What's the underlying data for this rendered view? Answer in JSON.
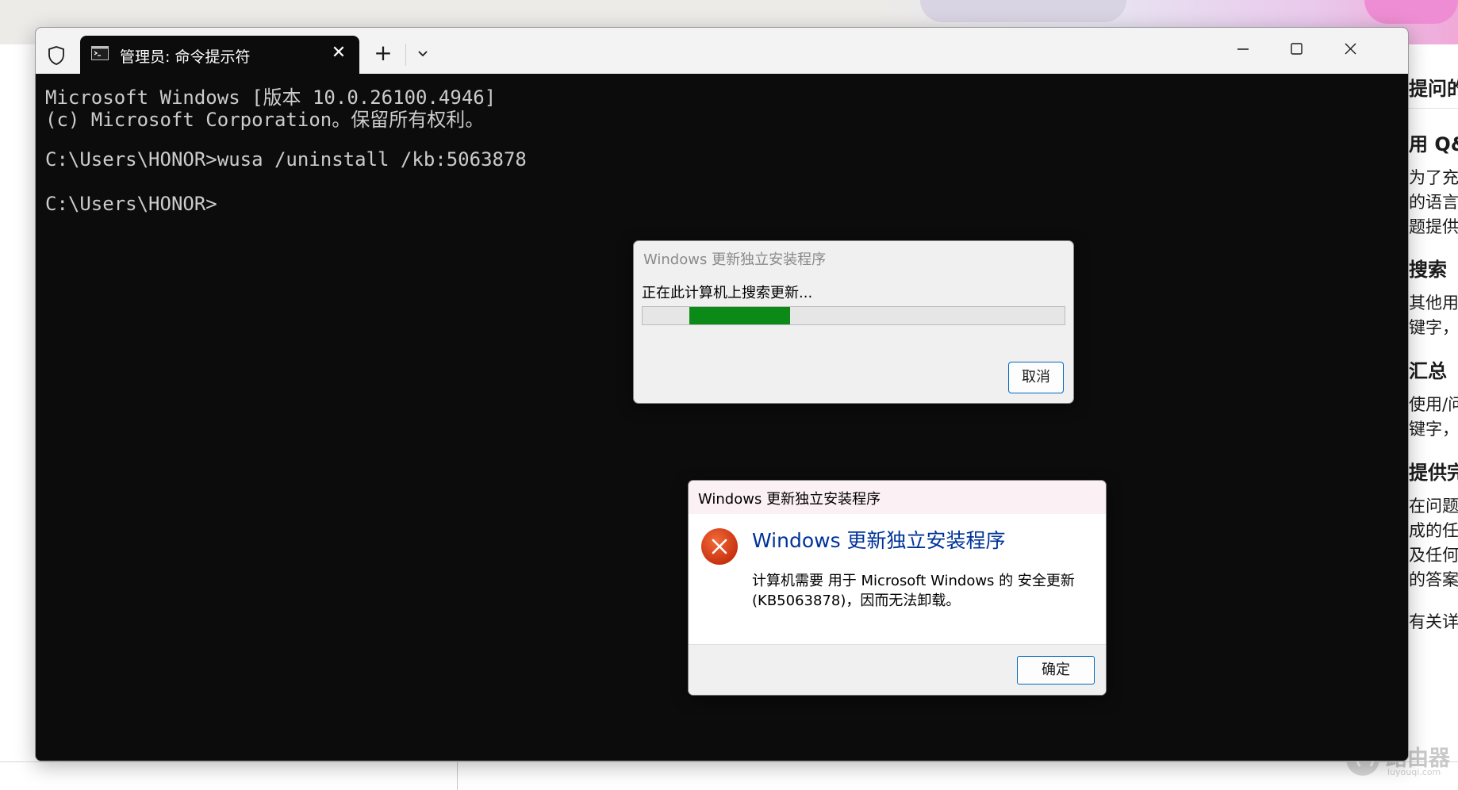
{
  "terminal": {
    "tab_title": "管理员: 命令提示符",
    "lines": [
      "Microsoft Windows [版本 10.0.26100.4946]",
      "(c) Microsoft Corporation。保留所有权利。",
      "",
      "C:\\Users\\HONOR>wusa /uninstall /kb:5063878",
      "",
      "C:\\Users\\HONOR>"
    ],
    "new_tab_label": "+",
    "close_tab_label": "✕"
  },
  "progress_dialog": {
    "title": "Windows 更新独立安装程序",
    "status": "正在此计算机上搜索更新...",
    "progress_segment": {
      "start": 0.11,
      "end": 0.35
    },
    "cancel_label": "取消",
    "bar_color": "#0b8a17"
  },
  "error_dialog": {
    "title": "Windows 更新独立安装程序",
    "heading": "Windows 更新独立安装程序",
    "message_line1": "计算机需要 用于 Microsoft Windows 的 安全更新",
    "message_line2": "(KB5063878)，因而无法卸载。",
    "ok_label": "确定",
    "icon": "error-icon",
    "accent": "#d83b01"
  },
  "background_article": {
    "lines": [
      {
        "text": "提问的",
        "kind": "h"
      },
      {
        "text": "用 Q&",
        "kind": "h"
      },
      {
        "text": "为了充",
        "kind": "p"
      },
      {
        "text": "的语言",
        "kind": "p"
      },
      {
        "text": "题提供",
        "kind": "p"
      },
      {
        "text": "搜索",
        "kind": "h"
      },
      {
        "text": "其他用",
        "kind": "p"
      },
      {
        "text": "键字，",
        "kind": "p"
      },
      {
        "text": "汇总",
        "kind": "h"
      },
      {
        "text": "使用/问",
        "kind": "p"
      },
      {
        "text": "键字，",
        "kind": "p"
      },
      {
        "text": "提供完",
        "kind": "h"
      },
      {
        "text": "在问题",
        "kind": "p"
      },
      {
        "text": "成的任",
        "kind": "p"
      },
      {
        "text": "及任何",
        "kind": "p"
      },
      {
        "text": "的答案",
        "kind": "p"
      },
      {
        "text": "有关详",
        "kind": "p"
      }
    ]
  },
  "watermark": {
    "text": "路由器",
    "sub": "luyouqi.com"
  }
}
